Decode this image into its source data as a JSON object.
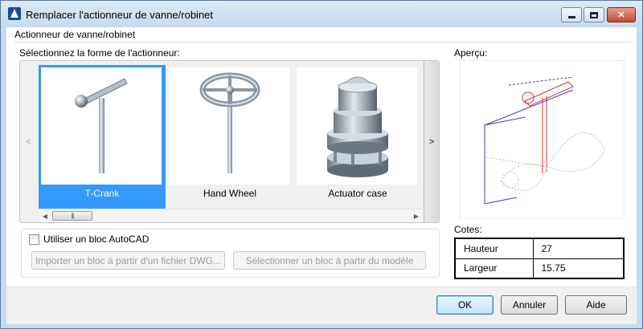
{
  "window": {
    "title": "Remplacer l'actionneur de vanne/robinet",
    "controls": {
      "minimize": "minimize",
      "maximize": "maximize",
      "close": "✕"
    }
  },
  "group": {
    "title": "Actionneur de vanne/robinet"
  },
  "picker": {
    "label": "Sélectionnez la forme de l'actionneur:",
    "prev_glyph": "<",
    "next_glyph": ">",
    "items": [
      {
        "label": "T-Crank",
        "icon": "t-crank-icon",
        "selected": true
      },
      {
        "label": "Hand Wheel",
        "icon": "hand-wheel-icon",
        "selected": false
      },
      {
        "label": "Actuator case",
        "icon": "actuator-case-icon",
        "selected": false
      }
    ],
    "scroll_left": "◀",
    "scroll_right": "▶",
    "scroll_grip": "|||"
  },
  "preview": {
    "label": "Aperçu:"
  },
  "block": {
    "checkbox_label": "Utiliser un bloc AutoCAD",
    "checked": false,
    "import_button": "Importer un bloc à partir d'un fichier DWG...",
    "select_button": "Sélectionner un bloc à partir du modèle"
  },
  "cotes": {
    "label": "Cotes:",
    "rows": [
      {
        "name": "Hauteur",
        "value": "27"
      },
      {
        "name": "Largeur",
        "value": "15.75"
      }
    ]
  },
  "footer": {
    "ok": "OK",
    "cancel": "Annuler",
    "help": "Aide"
  },
  "colors": {
    "selection": "#3399ff",
    "preview_blue": "#3a3ad8",
    "preview_red": "#e03030"
  }
}
